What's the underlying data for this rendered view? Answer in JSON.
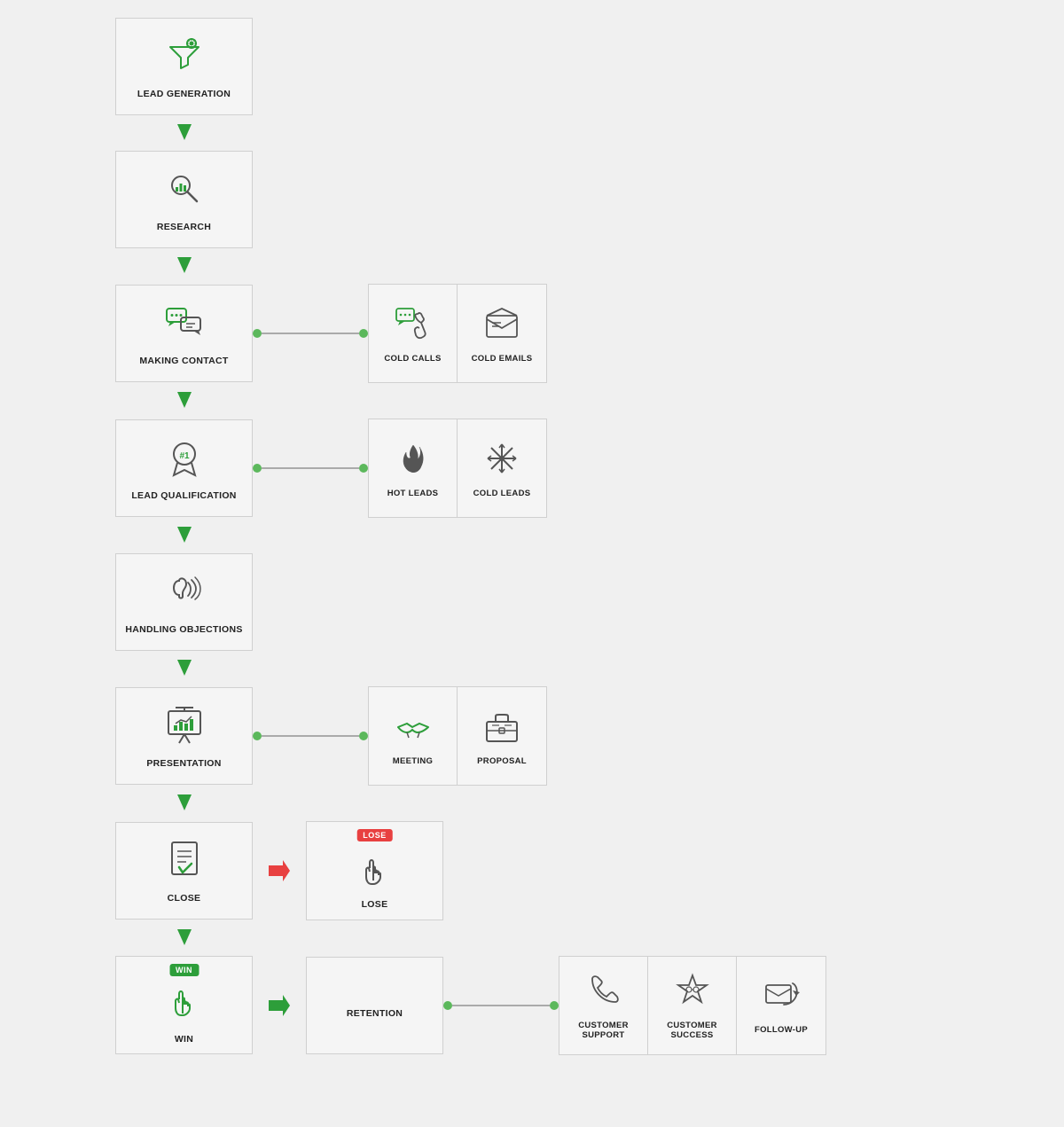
{
  "steps": [
    {
      "id": "lead-generation",
      "label": "LEAD GENERATION"
    },
    {
      "id": "research",
      "label": "RESEARCH"
    },
    {
      "id": "making-contact",
      "label": "MAKING CONTACT"
    },
    {
      "id": "lead-qualification",
      "label": "LEAD QUALIFICATION"
    },
    {
      "id": "handling-objections",
      "label": "HANDLING OBJECTIONS"
    },
    {
      "id": "presentation",
      "label": "PRESENTATION"
    },
    {
      "id": "close",
      "label": "CLOSE"
    },
    {
      "id": "win",
      "label": "WIN"
    }
  ],
  "side_groups": {
    "making_contact": [
      {
        "id": "cold-calls",
        "label": "COLD CALLS"
      },
      {
        "id": "cold-emails",
        "label": "COLD EMAILS"
      }
    ],
    "lead_qualification": [
      {
        "id": "hot-leads",
        "label": "HOT LEADS"
      },
      {
        "id": "cold-leads",
        "label": "COLD LEADS"
      }
    ],
    "presentation": [
      {
        "id": "meeting",
        "label": "MEETING"
      },
      {
        "id": "proposal",
        "label": "PROPOSAL"
      }
    ]
  },
  "lose": {
    "label": "LOSE",
    "badge": "LOSE"
  },
  "win_badge": "WIN",
  "retention": {
    "label": "RETENTION"
  },
  "after_retention": [
    {
      "id": "customer-support",
      "label": "CUSTOMER SUPPORT"
    },
    {
      "id": "customer-success",
      "label": "CUSTOMER SUCCESS"
    },
    {
      "id": "follow-up",
      "label": "FOLLOW-UP"
    }
  ],
  "colors": {
    "green": "#2d9e3a",
    "red": "#e84040",
    "box_border": "#d0d0d0",
    "box_bg": "#f5f5f5"
  }
}
